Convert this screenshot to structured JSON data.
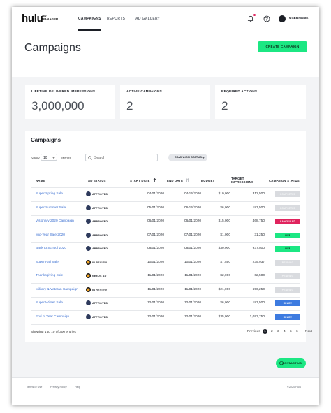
{
  "app": {
    "logo": "hulu",
    "logo_sub": "AD MANAGER",
    "nav": [
      "CAMPAIGNS",
      "REPORTS",
      "AD GALLERY"
    ],
    "username": "USERNAME"
  },
  "header": {
    "title": "Campaigns",
    "create_label": "CREATE CAMPAIGN"
  },
  "stats": [
    {
      "label": "LIFETIME DELIVERED IMPRESSIONS",
      "value": "3,000,000"
    },
    {
      "label": "ACTIVE CAMPAIGNS",
      "value": "2"
    },
    {
      "label": "REQUIRED ACTIONS",
      "value": "2"
    }
  ],
  "table": {
    "title": "Campaigns",
    "show_label": "Show",
    "page_size": "10",
    "entries_label": "entries",
    "search_placeholder": "Search",
    "filter_label": "CAMPAIGN STATUS",
    "columns": [
      "NAME",
      "AD STATUS",
      "START DATE",
      "END DATE",
      "BUDGET",
      "TARGET IMPRESSIONS",
      "CAMPAIGN STATUS"
    ],
    "rows": [
      {
        "name": "Super Spring Sale",
        "ad_status": "APPROVED",
        "start": "04/01/2020",
        "end": "04/15/2020",
        "budget": "$10,000",
        "impressions": "312,500",
        "status": "COMPLETED"
      },
      {
        "name": "Super Summer Sale",
        "ad_status": "APPROVED",
        "start": "05/01/2020",
        "end": "06/15/2020",
        "budget": "$6,000",
        "impressions": "187,500",
        "status": "COMPLETED"
      },
      {
        "name": "Visionary 2020 Campaign",
        "ad_status": "APPROVED",
        "start": "06/01/2020",
        "end": "06/01/2020",
        "budget": "$15,000",
        "impressions": "468,750",
        "status": "CANCELLED"
      },
      {
        "name": "Mid-Year Sale 2020",
        "ad_status": "APPROVED",
        "start": "07/01/2020",
        "end": "07/01/2020",
        "budget": "$1,000",
        "impressions": "31,250",
        "status": "LIVE"
      },
      {
        "name": "Back to School 2020",
        "ad_status": "APPROVED",
        "start": "08/01/2020",
        "end": "08/01/2020",
        "budget": "$30,000",
        "impressions": "937,500",
        "status": "LIVE"
      },
      {
        "name": "Super Fall Sale",
        "ad_status": "IN REVIEW",
        "start": "10/01/2020",
        "end": "10/01/2020",
        "budget": "$7,550",
        "impressions": "235,937",
        "status": "PENDING"
      },
      {
        "name": "Thanksgiving Sale",
        "ad_status": "NEEDS AD",
        "start": "11/01/2020",
        "end": "11/01/2020",
        "budget": "$2,000",
        "impressions": "62,500",
        "status": "PENDING"
      },
      {
        "name": "Military & Veteran Campaign",
        "ad_status": "IN REVIEW",
        "start": "11/01/2020",
        "end": "11/01/2020",
        "budget": "$21,000",
        "impressions": "656,250",
        "status": "PENDING"
      },
      {
        "name": "Super Winter Sale",
        "ad_status": "APPROVED",
        "start": "12/01/2020",
        "end": "12/01/2020",
        "budget": "$6,000",
        "impressions": "187,500",
        "status": "READY"
      },
      {
        "name": "End of Year Campaign",
        "ad_status": "APPROVED",
        "start": "12/01/2020",
        "end": "12/01/2020",
        "budget": "$35,000",
        "impressions": "1,093,750",
        "status": "READY"
      }
    ],
    "showing_text": "Showing 1 to 10 of 300 entries",
    "pager": {
      "previous": "Previous",
      "pages": [
        "1",
        "2",
        "3",
        "4",
        "5",
        "6"
      ],
      "next": "Next",
      "current": "1"
    }
  },
  "contact_label": "CONTACT US",
  "footer": {
    "links": [
      "Terms of Use",
      "Privacy Policy",
      "Help"
    ],
    "copyright": "©2020 Hulu"
  },
  "colors": {
    "accent_green": "#1ce783",
    "completed": "#d9dbdf",
    "cancelled": "#e0245e",
    "live": "#1ce783",
    "pending": "#d9dbdf",
    "ready": "#3d7be0",
    "approved_dot": "#2e3a5c",
    "review_dot": "#f5a623"
  },
  "icons": [
    "bell-icon",
    "help-icon",
    "search-icon",
    "chevron-down-icon",
    "sort-icon",
    "chat-icon"
  ]
}
